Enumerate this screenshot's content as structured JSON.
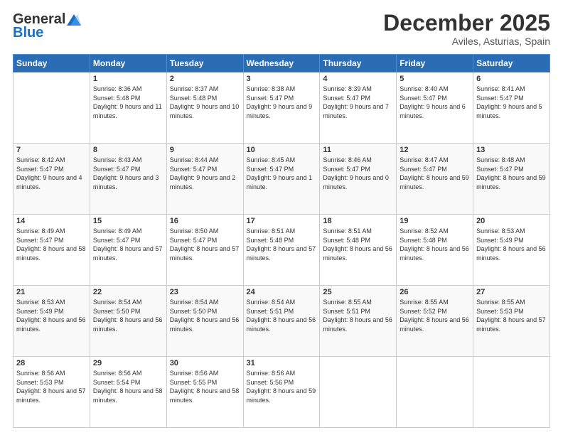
{
  "header": {
    "logo_general": "General",
    "logo_blue": "Blue",
    "month_title": "December 2025",
    "location": "Aviles, Asturias, Spain"
  },
  "weekdays": [
    "Sunday",
    "Monday",
    "Tuesday",
    "Wednesday",
    "Thursday",
    "Friday",
    "Saturday"
  ],
  "weeks": [
    [
      {
        "day": "",
        "sunrise": "",
        "sunset": "",
        "daylight": ""
      },
      {
        "day": "1",
        "sunrise": "Sunrise: 8:36 AM",
        "sunset": "Sunset: 5:48 PM",
        "daylight": "Daylight: 9 hours and 11 minutes."
      },
      {
        "day": "2",
        "sunrise": "Sunrise: 8:37 AM",
        "sunset": "Sunset: 5:48 PM",
        "daylight": "Daylight: 9 hours and 10 minutes."
      },
      {
        "day": "3",
        "sunrise": "Sunrise: 8:38 AM",
        "sunset": "Sunset: 5:47 PM",
        "daylight": "Daylight: 9 hours and 9 minutes."
      },
      {
        "day": "4",
        "sunrise": "Sunrise: 8:39 AM",
        "sunset": "Sunset: 5:47 PM",
        "daylight": "Daylight: 9 hours and 7 minutes."
      },
      {
        "day": "5",
        "sunrise": "Sunrise: 8:40 AM",
        "sunset": "Sunset: 5:47 PM",
        "daylight": "Daylight: 9 hours and 6 minutes."
      },
      {
        "day": "6",
        "sunrise": "Sunrise: 8:41 AM",
        "sunset": "Sunset: 5:47 PM",
        "daylight": "Daylight: 9 hours and 5 minutes."
      }
    ],
    [
      {
        "day": "7",
        "sunrise": "Sunrise: 8:42 AM",
        "sunset": "Sunset: 5:47 PM",
        "daylight": "Daylight: 9 hours and 4 minutes."
      },
      {
        "day": "8",
        "sunrise": "Sunrise: 8:43 AM",
        "sunset": "Sunset: 5:47 PM",
        "daylight": "Daylight: 9 hours and 3 minutes."
      },
      {
        "day": "9",
        "sunrise": "Sunrise: 8:44 AM",
        "sunset": "Sunset: 5:47 PM",
        "daylight": "Daylight: 9 hours and 2 minutes."
      },
      {
        "day": "10",
        "sunrise": "Sunrise: 8:45 AM",
        "sunset": "Sunset: 5:47 PM",
        "daylight": "Daylight: 9 hours and 1 minute."
      },
      {
        "day": "11",
        "sunrise": "Sunrise: 8:46 AM",
        "sunset": "Sunset: 5:47 PM",
        "daylight": "Daylight: 9 hours and 0 minutes."
      },
      {
        "day": "12",
        "sunrise": "Sunrise: 8:47 AM",
        "sunset": "Sunset: 5:47 PM",
        "daylight": "Daylight: 8 hours and 59 minutes."
      },
      {
        "day": "13",
        "sunrise": "Sunrise: 8:48 AM",
        "sunset": "Sunset: 5:47 PM",
        "daylight": "Daylight: 8 hours and 59 minutes."
      }
    ],
    [
      {
        "day": "14",
        "sunrise": "Sunrise: 8:49 AM",
        "sunset": "Sunset: 5:47 PM",
        "daylight": "Daylight: 8 hours and 58 minutes."
      },
      {
        "day": "15",
        "sunrise": "Sunrise: 8:49 AM",
        "sunset": "Sunset: 5:47 PM",
        "daylight": "Daylight: 8 hours and 57 minutes."
      },
      {
        "day": "16",
        "sunrise": "Sunrise: 8:50 AM",
        "sunset": "Sunset: 5:47 PM",
        "daylight": "Daylight: 8 hours and 57 minutes."
      },
      {
        "day": "17",
        "sunrise": "Sunrise: 8:51 AM",
        "sunset": "Sunset: 5:48 PM",
        "daylight": "Daylight: 8 hours and 57 minutes."
      },
      {
        "day": "18",
        "sunrise": "Sunrise: 8:51 AM",
        "sunset": "Sunset: 5:48 PM",
        "daylight": "Daylight: 8 hours and 56 minutes."
      },
      {
        "day": "19",
        "sunrise": "Sunrise: 8:52 AM",
        "sunset": "Sunset: 5:48 PM",
        "daylight": "Daylight: 8 hours and 56 minutes."
      },
      {
        "day": "20",
        "sunrise": "Sunrise: 8:53 AM",
        "sunset": "Sunset: 5:49 PM",
        "daylight": "Daylight: 8 hours and 56 minutes."
      }
    ],
    [
      {
        "day": "21",
        "sunrise": "Sunrise: 8:53 AM",
        "sunset": "Sunset: 5:49 PM",
        "daylight": "Daylight: 8 hours and 56 minutes."
      },
      {
        "day": "22",
        "sunrise": "Sunrise: 8:54 AM",
        "sunset": "Sunset: 5:50 PM",
        "daylight": "Daylight: 8 hours and 56 minutes."
      },
      {
        "day": "23",
        "sunrise": "Sunrise: 8:54 AM",
        "sunset": "Sunset: 5:50 PM",
        "daylight": "Daylight: 8 hours and 56 minutes."
      },
      {
        "day": "24",
        "sunrise": "Sunrise: 8:54 AM",
        "sunset": "Sunset: 5:51 PM",
        "daylight": "Daylight: 8 hours and 56 minutes."
      },
      {
        "day": "25",
        "sunrise": "Sunrise: 8:55 AM",
        "sunset": "Sunset: 5:51 PM",
        "daylight": "Daylight: 8 hours and 56 minutes."
      },
      {
        "day": "26",
        "sunrise": "Sunrise: 8:55 AM",
        "sunset": "Sunset: 5:52 PM",
        "daylight": "Daylight: 8 hours and 56 minutes."
      },
      {
        "day": "27",
        "sunrise": "Sunrise: 8:55 AM",
        "sunset": "Sunset: 5:53 PM",
        "daylight": "Daylight: 8 hours and 57 minutes."
      }
    ],
    [
      {
        "day": "28",
        "sunrise": "Sunrise: 8:56 AM",
        "sunset": "Sunset: 5:53 PM",
        "daylight": "Daylight: 8 hours and 57 minutes."
      },
      {
        "day": "29",
        "sunrise": "Sunrise: 8:56 AM",
        "sunset": "Sunset: 5:54 PM",
        "daylight": "Daylight: 8 hours and 58 minutes."
      },
      {
        "day": "30",
        "sunrise": "Sunrise: 8:56 AM",
        "sunset": "Sunset: 5:55 PM",
        "daylight": "Daylight: 8 hours and 58 minutes."
      },
      {
        "day": "31",
        "sunrise": "Sunrise: 8:56 AM",
        "sunset": "Sunset: 5:56 PM",
        "daylight": "Daylight: 8 hours and 59 minutes."
      },
      {
        "day": "",
        "sunrise": "",
        "sunset": "",
        "daylight": ""
      },
      {
        "day": "",
        "sunrise": "",
        "sunset": "",
        "daylight": ""
      },
      {
        "day": "",
        "sunrise": "",
        "sunset": "",
        "daylight": ""
      }
    ]
  ]
}
